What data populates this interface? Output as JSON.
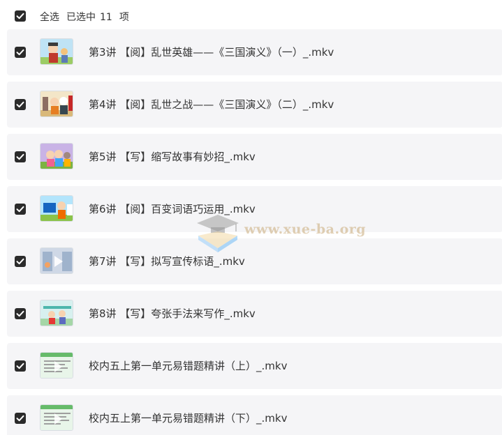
{
  "header": {
    "select_all_label": "全选",
    "selected_prefix": "已选中",
    "selected_count": "11",
    "selected_suffix": "项"
  },
  "files": [
    {
      "name": "第3讲 【阅】乱世英雄——《三国演义》（一）_.mkv",
      "checked": true
    },
    {
      "name": "第4讲 【阅】乱世之战——《三国演义》（二）_.mkv",
      "checked": true
    },
    {
      "name": "第5讲 【写】缩写故事有妙招_.mkv",
      "checked": true
    },
    {
      "name": "第6讲 【阅】百变词语巧运用_.mkv",
      "checked": true
    },
    {
      "name": "第7讲 【写】拟写宣传标语_.mkv",
      "checked": true
    },
    {
      "name": "第8讲 【写】夸张手法来写作_.mkv",
      "checked": true
    },
    {
      "name": "校内五上第一单元易错题精讲（上）_.mkv",
      "checked": true
    },
    {
      "name": "校内五上第一单元易错题精讲（下）_.mkv",
      "checked": true
    }
  ],
  "thumbnails": [
    "cartoon-thumbnail",
    "cartoon-thumbnail",
    "cartoon-thumbnail",
    "cartoon-thumbnail",
    "video-play-thumbnail",
    "cartoon-thumbnail",
    "worksheet-thumbnail",
    "worksheet-thumbnail"
  ],
  "watermark": {
    "text": "www.xue-ba.org",
    "icon": "graduation-cap-book-icon"
  },
  "colors": {
    "row_background": "#f5f5f7",
    "checkbox_fill": "#2b2b2b",
    "text": "#333333"
  }
}
